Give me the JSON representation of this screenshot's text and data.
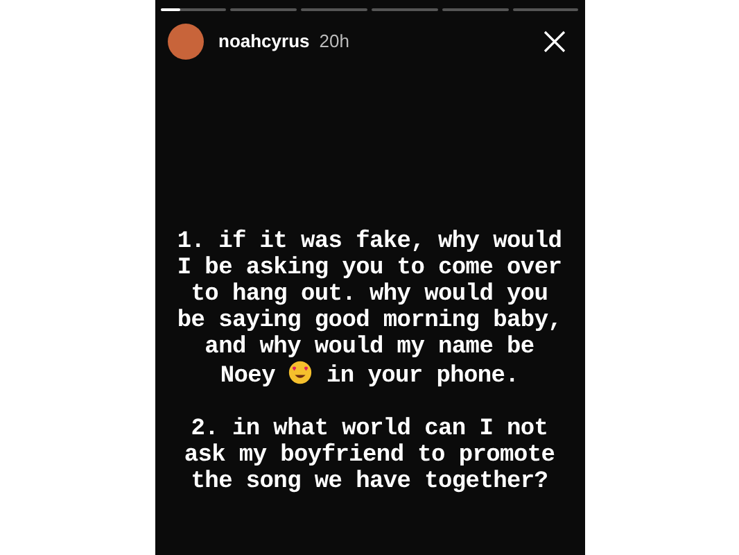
{
  "progress": [
    {
      "level": 0.3
    },
    {
      "level": 0
    },
    {
      "level": 0
    },
    {
      "level": 0
    },
    {
      "level": 0
    },
    {
      "level": 0
    }
  ],
  "header": {
    "username": "noahcyrus",
    "time": "20h"
  },
  "paragraphs": [
    [
      [
        {
          "kind": "text",
          "text": "1. if it was fake, why would"
        }
      ],
      [
        {
          "kind": "text",
          "text": "I be asking you to come over"
        }
      ],
      [
        {
          "kind": "text",
          "text": "to hang out. why would you"
        }
      ],
      [
        {
          "kind": "text",
          "text": "be saying good morning baby,"
        }
      ],
      [
        {
          "kind": "text",
          "text": "and why would my name be"
        }
      ],
      [
        {
          "kind": "text",
          "text": "Noey"
        },
        {
          "kind": "emoji"
        },
        {
          "kind": "text",
          "text": "in your phone."
        }
      ]
    ],
    [
      [
        {
          "kind": "text",
          "text": "2. in what world can I not"
        }
      ],
      [
        {
          "kind": "text",
          "text": "ask my boyfriend to promote"
        }
      ],
      [
        {
          "kind": "text",
          "text": "the song we have together?"
        }
      ]
    ]
  ]
}
